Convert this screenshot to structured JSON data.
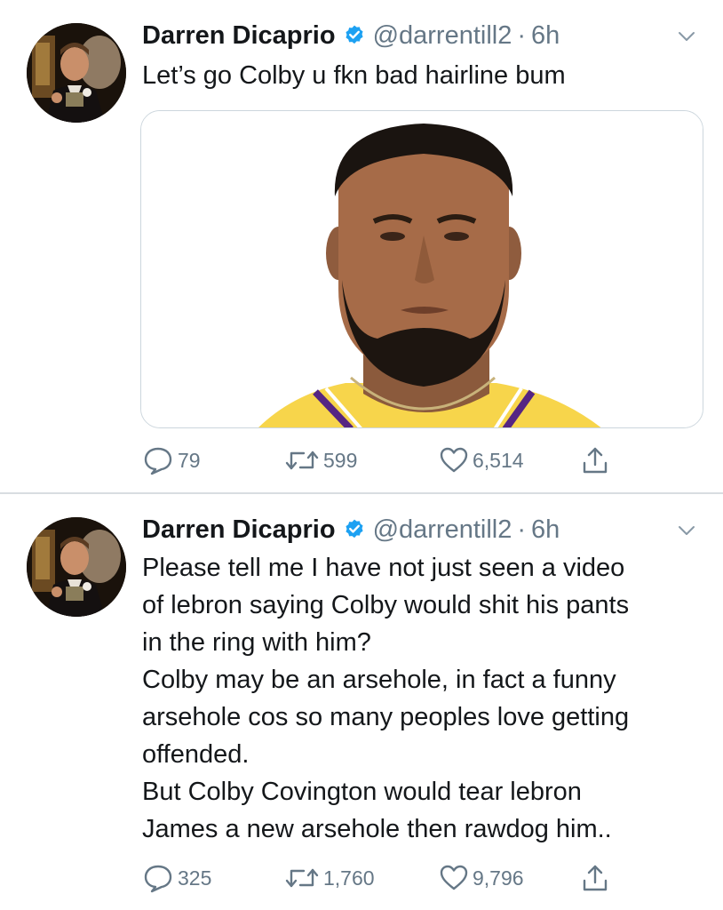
{
  "tweets": [
    {
      "name": "Darren Dicaprio",
      "handle": "@darrentill2",
      "separator": "·",
      "time": "6h",
      "text_lines": [
        "Let’s go Colby u fkn bad hairline bum"
      ],
      "stats": {
        "replies": "79",
        "retweets": "599",
        "likes": "6,514"
      }
    },
    {
      "name": "Darren Dicaprio",
      "handle": "@darrentill2",
      "separator": "·",
      "time": "6h",
      "text_lines": [
        "Please tell me I have not just seen a video",
        "of lebron saying Colby would shit his pants",
        "in the ring with him?",
        "Colby may be an arsehole, in fact a funny",
        "arsehole cos so many peoples love getting",
        "offended.",
        "But Colby Covington would tear lebron",
        "James a new arsehole then rawdog him.."
      ],
      "stats": {
        "replies": "325",
        "retweets": "1,760",
        "likes": "9,796"
      }
    }
  ],
  "icons": {
    "verified": "verified-badge-icon",
    "caret": "chevron-down-icon",
    "reply": "reply-bubble-icon",
    "retweet": "retweet-icon",
    "like": "heart-icon",
    "share": "share-upload-icon"
  },
  "colors": {
    "verified_blue": "#1da1f2",
    "secondary_text": "#657786",
    "primary_text": "#14171a",
    "divider": "#d8dde1",
    "jersey_yellow": "#f7d54b",
    "jersey_purple": "#552583"
  }
}
